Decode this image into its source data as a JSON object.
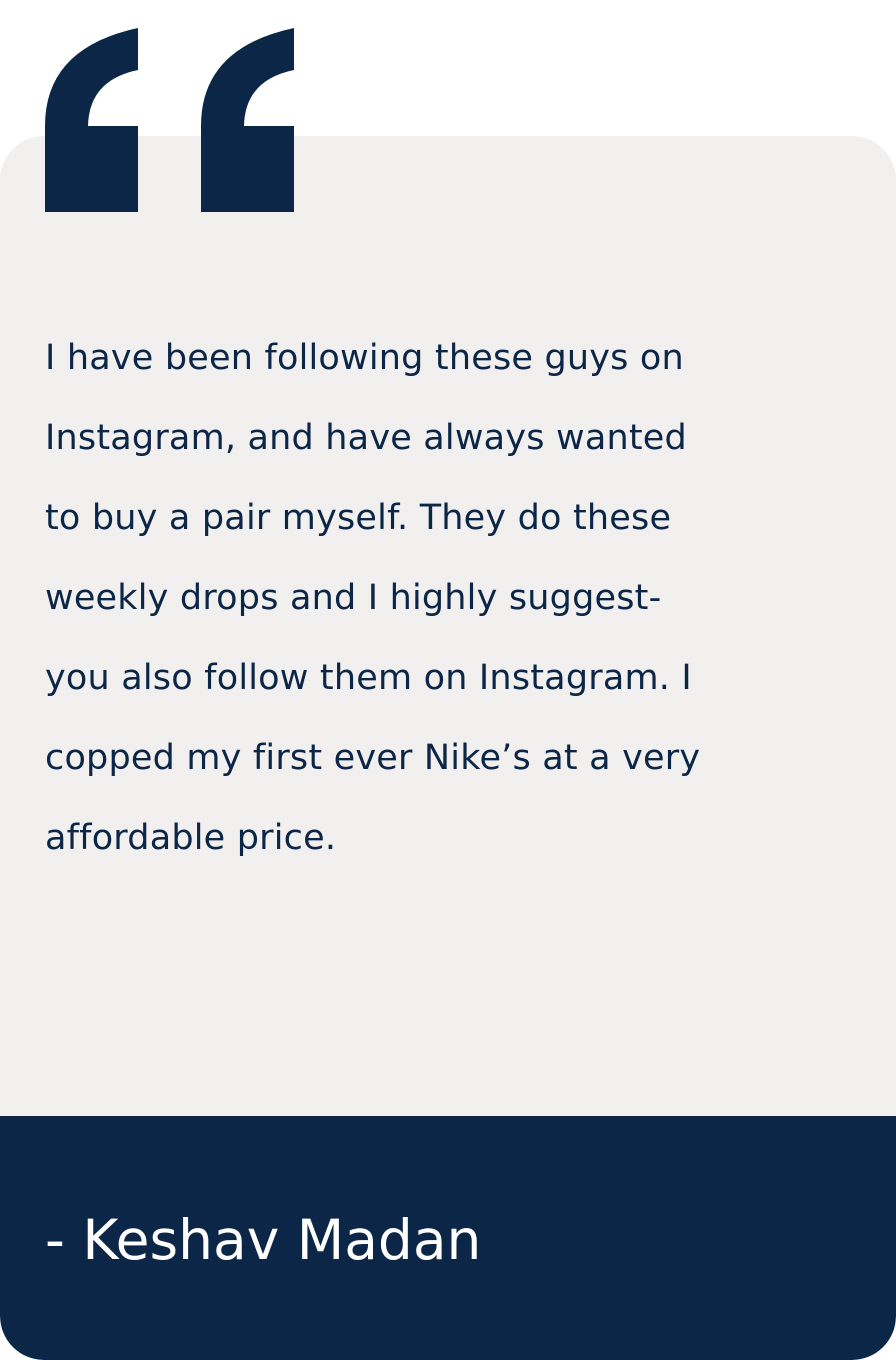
{
  "testimonial": {
    "quote_icon": "opening-quote-icon",
    "quote": "I have been following these guys on\nInstagram, and have always wanted\nto buy a pair myself. They do these\nweekly drops and I highly suggest-\nyou also follow them on Instagram. I\ncopped my first ever Nike’s at a very\naffordable price.",
    "author": "- Keshav Madan"
  },
  "colors": {
    "navy": "#0c2647",
    "card_background": "#f2f0ee",
    "page_background": "#ffffff",
    "author_text": "#ffffff"
  }
}
